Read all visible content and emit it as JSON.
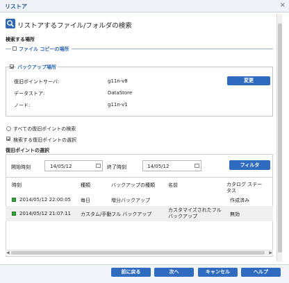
{
  "window": {
    "title": "リストア",
    "close": "×"
  },
  "header": {
    "title": "リストアするファイル/フォルダの検索"
  },
  "search_location": {
    "label": "検索する場所",
    "file_copy_label": "ファイル コピーの場所",
    "backup_label": "バックアップ場所",
    "rows": [
      {
        "label": "復旧ポイントサーバ:",
        "value": "g11n-v8"
      },
      {
        "label": "データストア:",
        "value": "DataStore"
      },
      {
        "label": "ノード:",
        "value": "g11n-v1"
      }
    ],
    "change_button": "変更"
  },
  "recovery_options": {
    "all_points": "すべての復旧ポイントの検索",
    "select_points": "検索する復旧ポイントの選択"
  },
  "recovery_select": {
    "label": "復旧ポイントの選択",
    "start_label": "開始時刻",
    "start_value": "14/05/12",
    "end_label": "終了時刻",
    "end_value": "14/05/12",
    "filter_button": "フィルタ"
  },
  "table": {
    "columns": [
      "時刻",
      "種類",
      "バックアップの種類",
      "名前",
      "カタログ ステータス"
    ],
    "rows": [
      {
        "time": "2014/05/12 22:00:05",
        "type": "毎日",
        "backup_type": "増分バックアップ",
        "name": "",
        "status": "作成済み"
      },
      {
        "time": "2014/05/12 21:07:11",
        "type": "カスタム/手動",
        "backup_type": "フル バックアップ",
        "name": "カスタマイズされたフル バックアップ",
        "status": "無効"
      }
    ]
  },
  "footer": {
    "back": "前に戻る",
    "next": "次へ",
    "cancel": "キャンセル",
    "help": "ヘルプ"
  }
}
